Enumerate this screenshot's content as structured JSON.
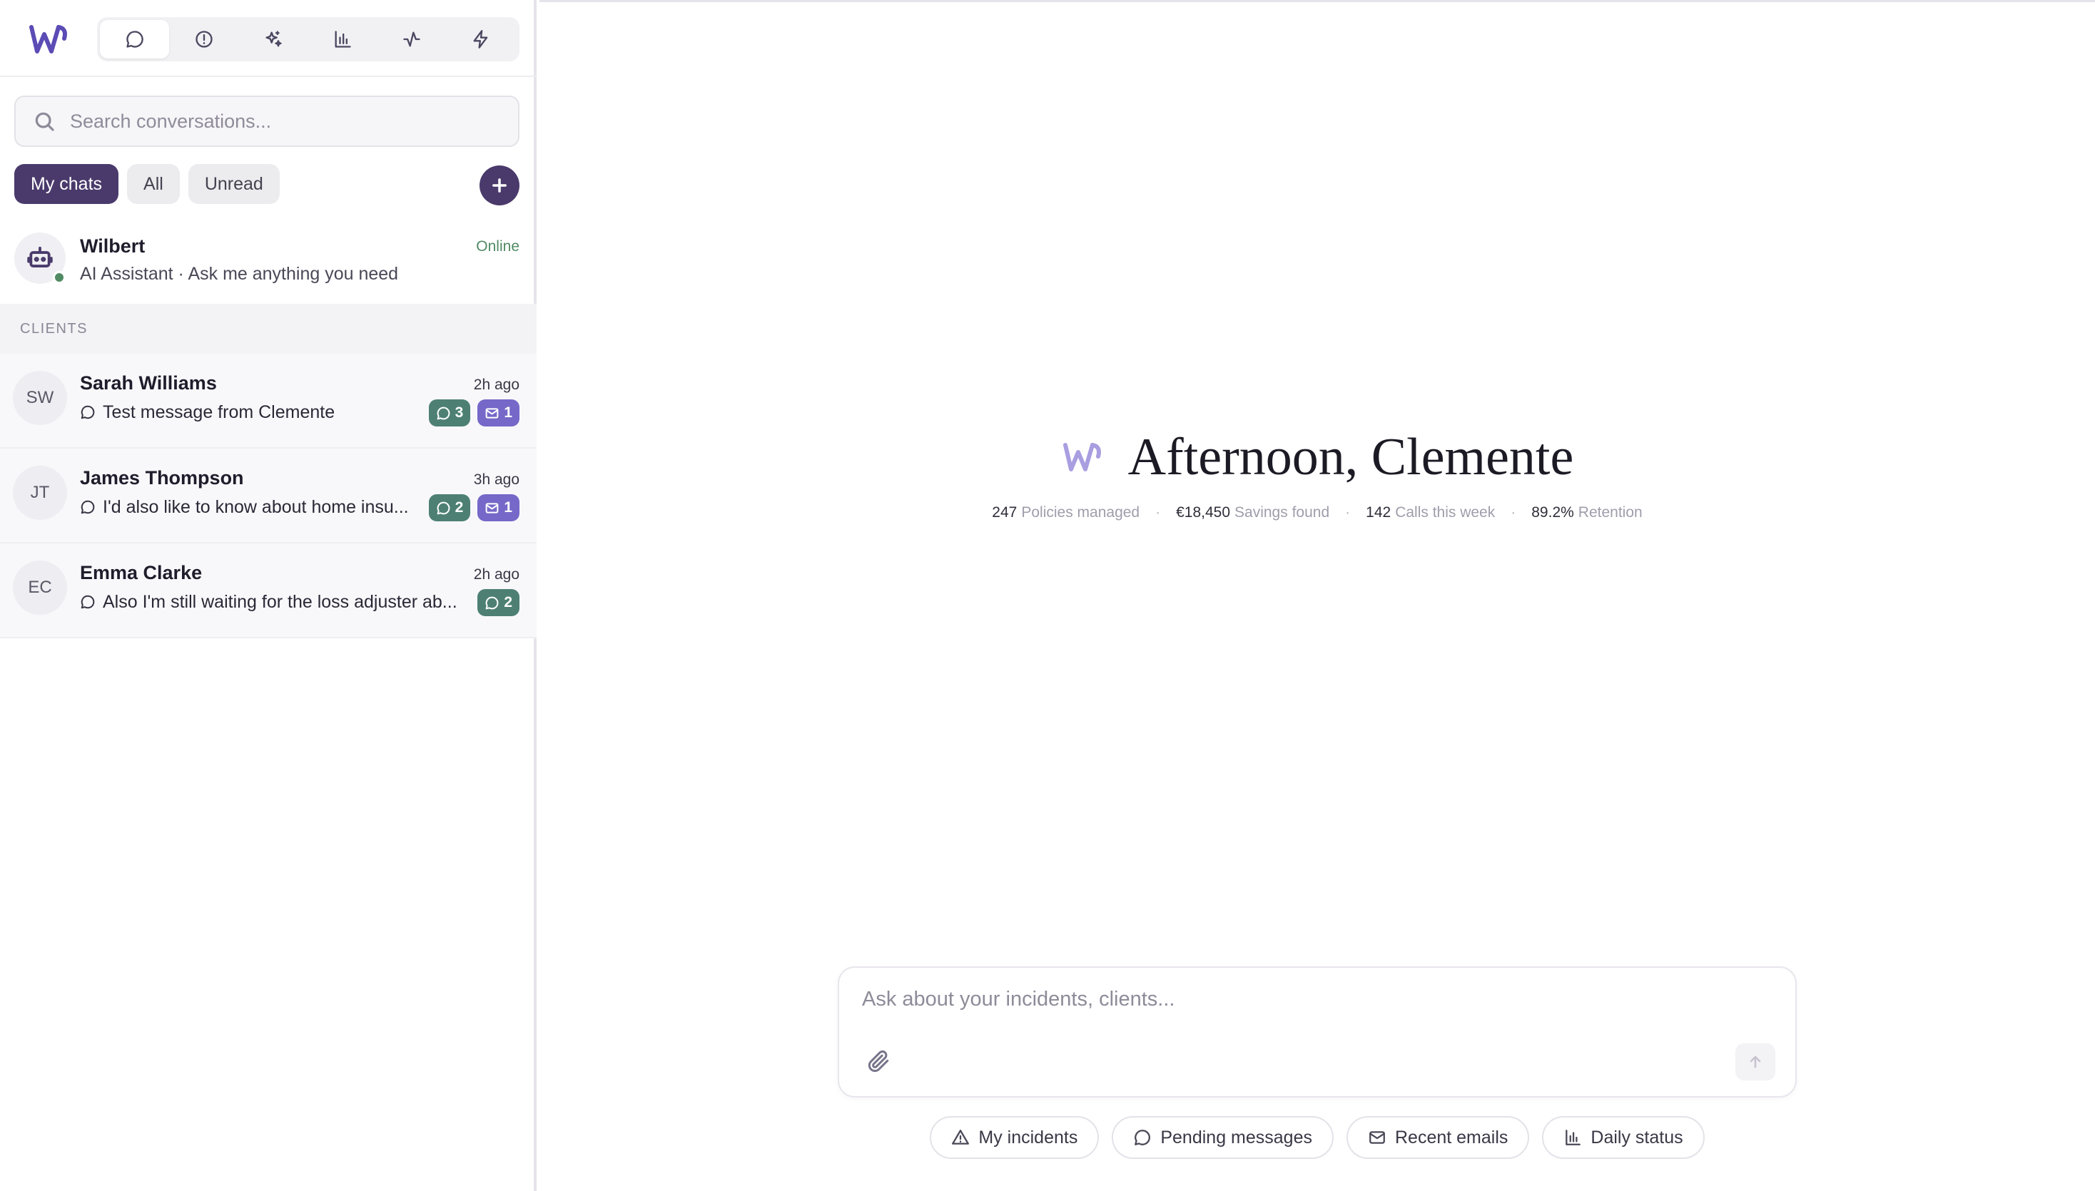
{
  "nav": {
    "tabs": [
      {
        "icon": "chat-bubble-icon",
        "active": true
      },
      {
        "icon": "alert-circle-icon",
        "active": false
      },
      {
        "icon": "sparkles-icon",
        "active": false
      },
      {
        "icon": "bar-chart-icon",
        "active": false
      },
      {
        "icon": "activity-icon",
        "active": false
      },
      {
        "icon": "lightning-icon",
        "active": false
      }
    ]
  },
  "search": {
    "placeholder": "Search conversations..."
  },
  "filters": {
    "my_chats": "My chats",
    "all": "All",
    "unread": "Unread",
    "active": "My chats"
  },
  "assistant": {
    "name": "Wilbert",
    "subtitle": "AI Assistant · Ask me anything you need",
    "status": "Online"
  },
  "section_label": "CLIENTS",
  "clients": [
    {
      "initials": "SW",
      "name": "Sarah Williams",
      "time": "2h ago",
      "preview": "Test message from Clemente",
      "chat_count": "3",
      "mail_count": "1"
    },
    {
      "initials": "JT",
      "name": "James Thompson",
      "time": "3h ago",
      "preview": "I'd also like to know about home insu...",
      "chat_count": "2",
      "mail_count": "1"
    },
    {
      "initials": "EC",
      "name": "Emma Clarke",
      "time": "2h ago",
      "preview": "Also I'm still waiting for the loss adjuster ab...",
      "chat_count": "2",
      "mail_count": null
    }
  ],
  "hero": {
    "greeting": "Afternoon, Clemente"
  },
  "stats": [
    {
      "value": "247",
      "label": "Policies managed"
    },
    {
      "value": "€18,450",
      "label": "Savings found"
    },
    {
      "value": "142",
      "label": "Calls this week"
    },
    {
      "value": "89.2%",
      "label": "Retention"
    }
  ],
  "composer": {
    "placeholder": "Ask about your incidents, clients..."
  },
  "quick_actions": [
    {
      "label": "My incidents",
      "icon": "warning-triangle-icon"
    },
    {
      "label": "Pending messages",
      "icon": "chat-bubble-icon"
    },
    {
      "label": "Recent emails",
      "icon": "mail-icon"
    },
    {
      "label": "Daily status",
      "icon": "bar-chart-icon"
    }
  ],
  "colors": {
    "brand": "#4a3a6b",
    "logo": "#5b4bb5",
    "online": "#4f8a63",
    "chat_badge": "#4d8073",
    "mail_badge": "#7568c8"
  }
}
